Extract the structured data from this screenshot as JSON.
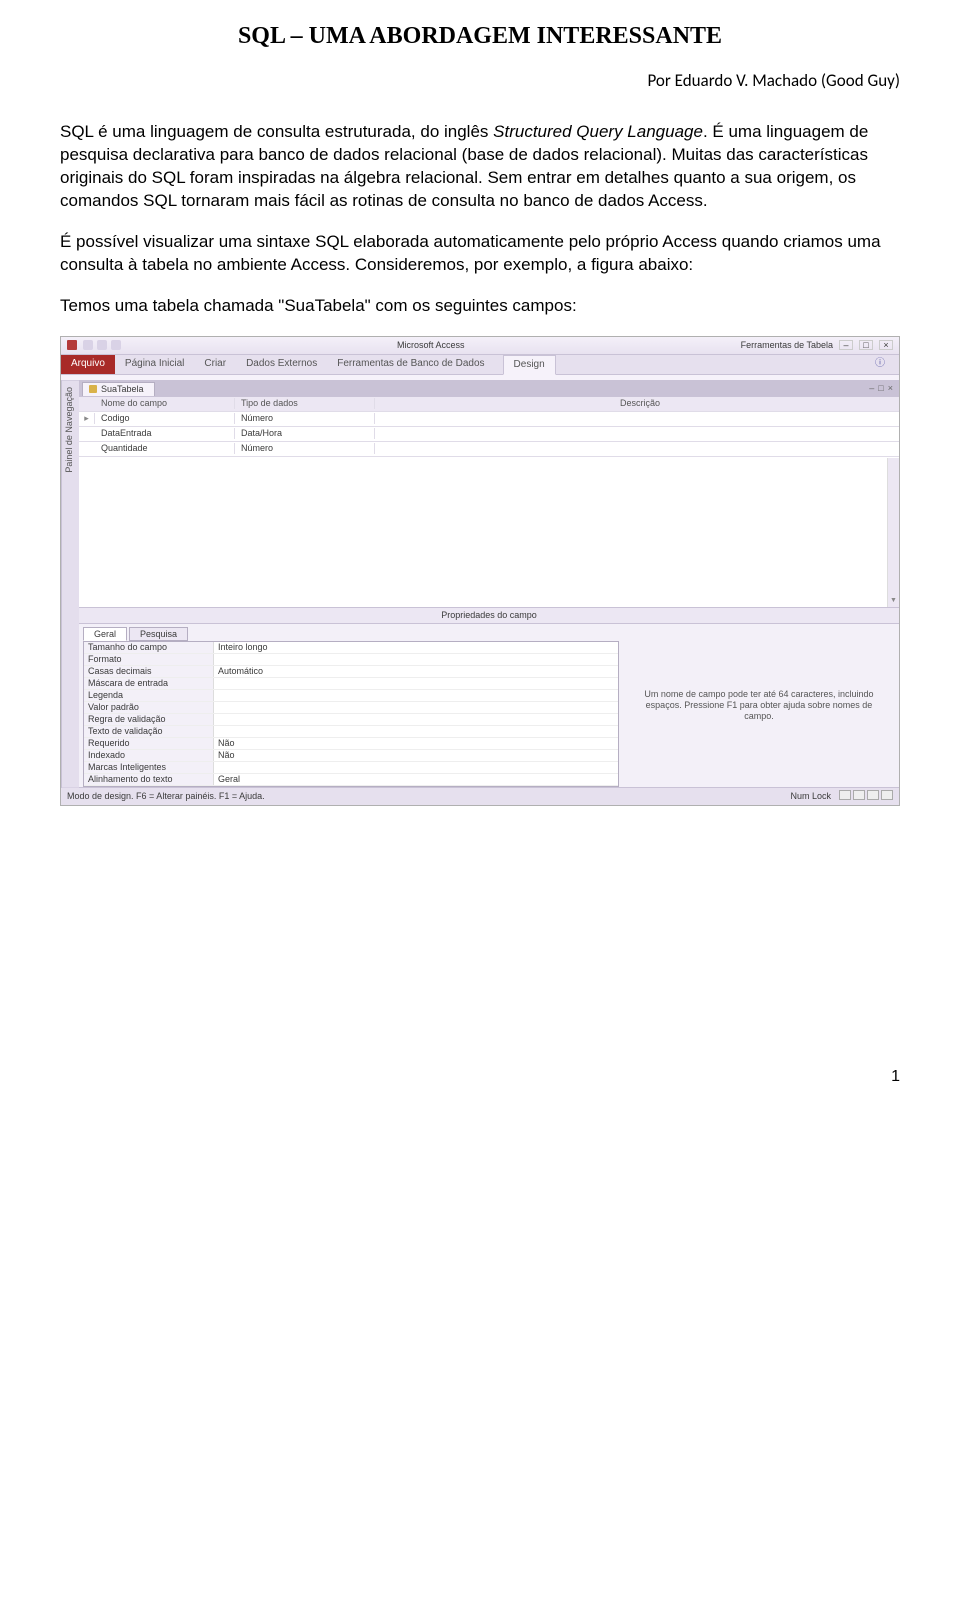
{
  "doc": {
    "title": "SQL – UMA ABORDAGEM INTERESSANTE",
    "author": "Por Eduardo V. Machado (Good Guy)",
    "p1a": "SQL é uma linguagem de consulta estruturada, do inglês ",
    "p1b": "Structured Query Language",
    "p1c": ". É uma linguagem de pesquisa declarativa para banco de dados relacional (base de dados relacional). Muitas das características originais do SQL foram inspiradas na álgebra relacional. Sem entrar em detalhes quanto a sua origem, os comandos SQL tornaram mais fácil as rotinas de consulta no banco de dados Access.",
    "p2": "É possível visualizar uma sintaxe SQL elaborada automaticamente pelo próprio Access quando criamos uma consulta à tabela no ambiente Access. Consideremos, por exemplo, a figura abaixo:",
    "p3": "Temos uma tabela chamada \"SuaTabela\" com os seguintes campos:",
    "page_number": "1"
  },
  "access": {
    "app_title": "Microsoft Access",
    "context_group": "Ferramentas de Tabela",
    "tabs": {
      "file": "Arquivo",
      "home": "Página Inicial",
      "create": "Criar",
      "external": "Dados Externos",
      "dbtools": "Ferramentas de Banco de Dados",
      "design": "Design"
    },
    "nav_pane": "Painel de Navegação",
    "doc_tab": "SuaTabela",
    "grid_headers": {
      "name": "Nome do campo",
      "type": "Tipo de dados",
      "desc": "Descrição"
    },
    "fields": [
      {
        "name": "Codigo",
        "type": "Número"
      },
      {
        "name": "DataEntrada",
        "type": "Data/Hora"
      },
      {
        "name": "Quantidade",
        "type": "Número"
      }
    ],
    "props_title": "Propriedades do campo",
    "prop_tabs": {
      "general": "Geral",
      "lookup": "Pesquisa"
    },
    "props": [
      {
        "k": "Tamanho do campo",
        "v": "Inteiro longo"
      },
      {
        "k": "Formato",
        "v": ""
      },
      {
        "k": "Casas decimais",
        "v": "Automático"
      },
      {
        "k": "Máscara de entrada",
        "v": ""
      },
      {
        "k": "Legenda",
        "v": ""
      },
      {
        "k": "Valor padrão",
        "v": ""
      },
      {
        "k": "Regra de validação",
        "v": ""
      },
      {
        "k": "Texto de validação",
        "v": ""
      },
      {
        "k": "Requerido",
        "v": "Não"
      },
      {
        "k": "Indexado",
        "v": "Não"
      },
      {
        "k": "Marcas Inteligentes",
        "v": ""
      },
      {
        "k": "Alinhamento do texto",
        "v": "Geral"
      }
    ],
    "help_text": "Um nome de campo pode ter até 64 caracteres, incluindo espaços. Pressione F1 para obter ajuda sobre nomes de campo.",
    "status_left": "Modo de design. F6 = Alterar painéis. F1 = Ajuda.",
    "status_right": "Num Lock"
  }
}
